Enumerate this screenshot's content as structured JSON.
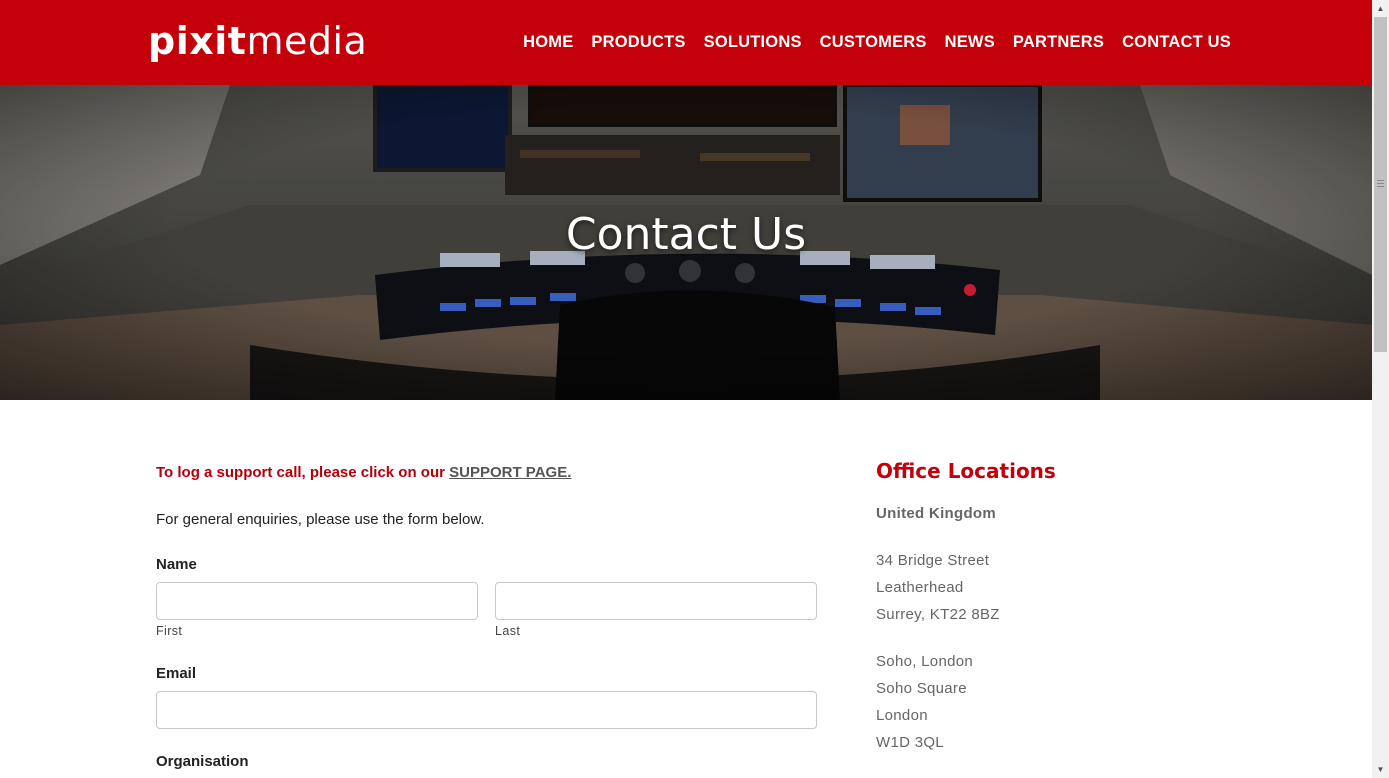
{
  "header": {
    "logo_bold": "pixit",
    "logo_light": "media",
    "nav": [
      "HOME",
      "PRODUCTS",
      "SOLUTIONS",
      "CUSTOMERS",
      "NEWS",
      "PARTNERS",
      "CONTACT US"
    ]
  },
  "hero": {
    "title": "Contact Us"
  },
  "main": {
    "support_text": "To log a support call, please click on our ",
    "support_link": "SUPPORT PAGE.",
    "general_text": "For general enquiries, please use the form below.",
    "form": {
      "name_label": "Name",
      "first_label": "First",
      "last_label": "Last",
      "email_label": "Email",
      "organisation_label": "Organisation"
    }
  },
  "offices": {
    "title": "Office Locations",
    "country": "United Kingdom",
    "uk_office": [
      "34 Bridge Street",
      "Leatherhead",
      "Surrey, KT22 8BZ"
    ],
    "london_office": [
      "Soho, London",
      "Soho Square",
      "London",
      "W1D 3QL"
    ]
  },
  "colors": {
    "brand_red": "#c4000a",
    "support_red": "#b3000b"
  }
}
